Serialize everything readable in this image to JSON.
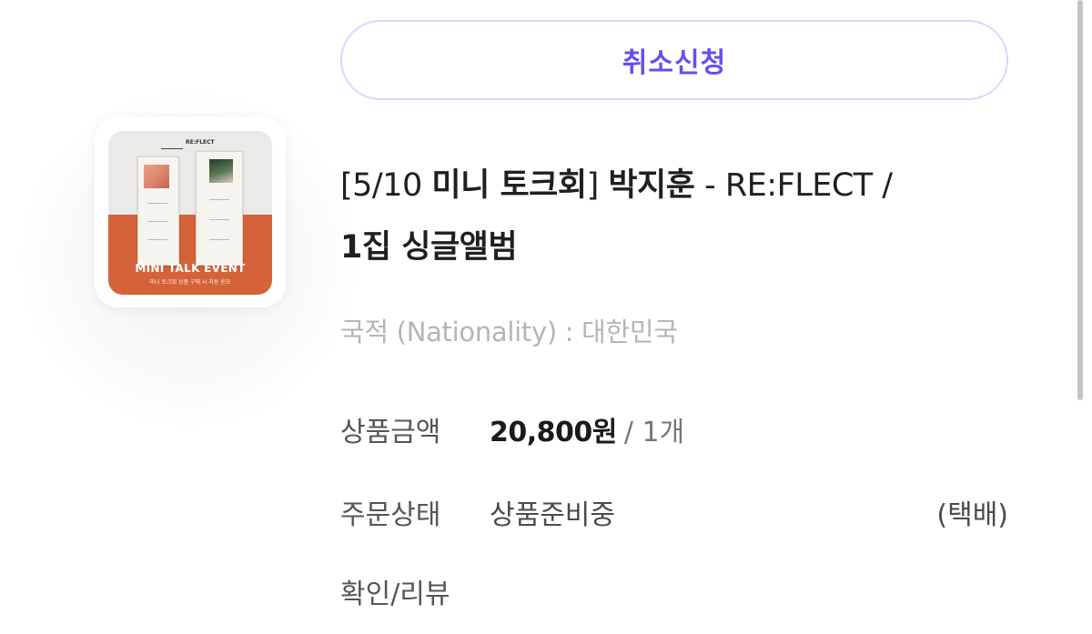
{
  "order": {
    "cancel_button_label": "취소신청",
    "product": {
      "title_prefix": "[5/10 ",
      "title_bold_1": "미니 토크회",
      "title_mid": "] ",
      "title_bold_2": "박지훈",
      "title_suffix": " - RE:FLECT /",
      "title_line2_bold": "1집 싱글앨범",
      "nationality": "국적 (Nationality) : 대한민국",
      "thumbnail": {
        "logo_text": "RE:FLECT",
        "event_title": "MINI TALK EVENT",
        "event_subtitle": "미니 토크회 상품 구매 시 자동 응모",
        "band_color": "#d4633a"
      }
    },
    "details": {
      "price_label": "상품금액",
      "price_amount": "20,800원",
      "price_qty": "/ 1개",
      "status_label": "주문상태",
      "status_value": "상품준비중",
      "delivery_type": "(택배)",
      "review_label": "확인/리뷰"
    },
    "accent_color": "#6a4cf0"
  }
}
